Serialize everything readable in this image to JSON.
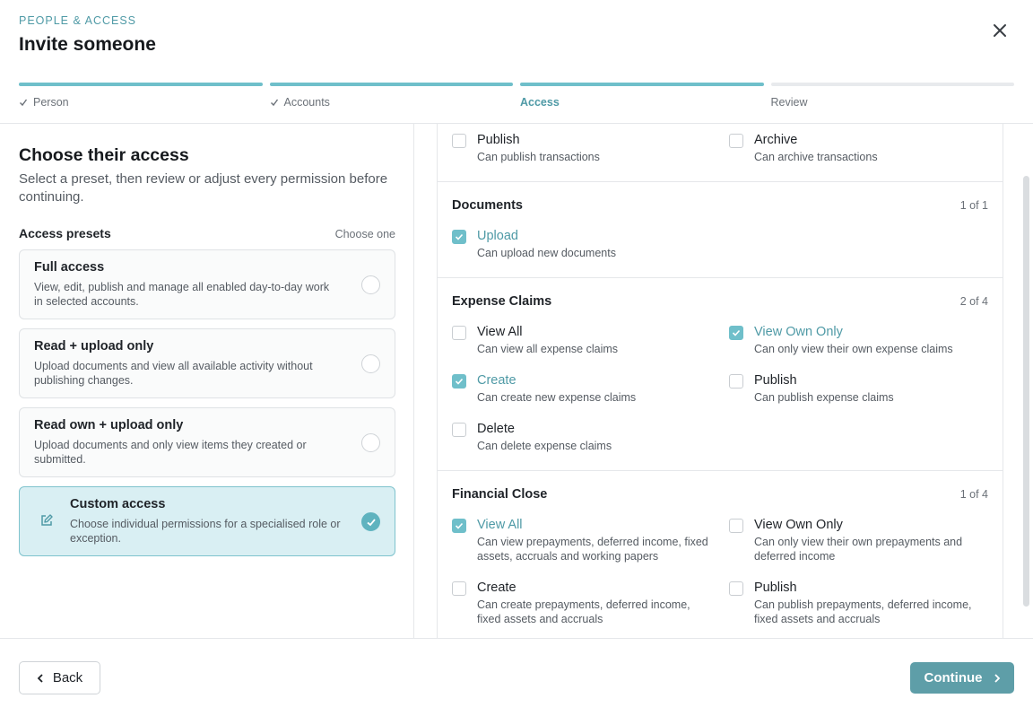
{
  "header": {
    "eyebrow": "PEOPLE & ACCESS",
    "title": "Invite someone",
    "close_icon": "close-icon"
  },
  "steps": [
    {
      "label": "Person",
      "state": "done"
    },
    {
      "label": "Accounts",
      "state": "done"
    },
    {
      "label": "Access",
      "state": "active"
    },
    {
      "label": "Review",
      "state": "upcoming"
    }
  ],
  "left": {
    "title": "Choose their access",
    "description": "Select a preset, then review or adjust every permission before continuing.",
    "presets_heading": "Access presets",
    "presets_hint": "Choose one",
    "presets": [
      {
        "title": "Full access",
        "description": "View, edit, publish and manage all enabled day-to-day work in selected accounts.",
        "selected": false
      },
      {
        "title": "Read + upload only",
        "description": "Upload documents and view all available activity without publishing changes.",
        "selected": false
      },
      {
        "title": "Read own + upload only",
        "description": "Upload documents and only view items they created or submitted.",
        "selected": false
      },
      {
        "title": "Custom access",
        "description": "Choose individual permissions for a specialised role or exception.",
        "selected": true,
        "icon": "edit-icon"
      }
    ]
  },
  "sections": {
    "top": {
      "perms": [
        {
          "name": "Publish",
          "desc": "Can publish transactions",
          "checked": false
        },
        {
          "name": "Archive",
          "desc": "Can archive transactions",
          "checked": false
        }
      ]
    },
    "documents": {
      "name": "Documents",
      "count": "1 of 1",
      "perms": [
        {
          "name": "Upload",
          "desc": "Can upload new documents",
          "checked": true
        }
      ]
    },
    "expense": {
      "name": "Expense Claims",
      "count": "2 of 4",
      "perms": [
        {
          "name": "View All",
          "desc": "Can view all expense claims",
          "checked": false
        },
        {
          "name": "View Own Only",
          "desc": "Can only view their own expense claims",
          "checked": true
        },
        {
          "name": "Create",
          "desc": "Can create new expense claims",
          "checked": true
        },
        {
          "name": "Publish",
          "desc": "Can publish expense claims",
          "checked": false
        },
        {
          "name": "Delete",
          "desc": "Can delete expense claims",
          "checked": false
        }
      ]
    },
    "financial": {
      "name": "Financial Close",
      "count": "1 of 4",
      "perms": [
        {
          "name": "View All",
          "desc": "Can view prepayments, deferred income, fixed assets, accruals and working papers",
          "checked": true
        },
        {
          "name": "View Own Only",
          "desc": "Can only view their own prepayments and deferred income",
          "checked": false
        },
        {
          "name": "Create",
          "desc": "Can create prepayments, deferred income, fixed assets and accruals",
          "checked": false
        },
        {
          "name": "Publish",
          "desc": "Can publish prepayments, deferred income, fixed assets and accruals",
          "checked": false
        }
      ]
    }
  },
  "footer": {
    "back_label": "Back",
    "continue_label": "Continue"
  },
  "colors": {
    "accent": "#6fbfca",
    "accent_text": "#4f9aa6",
    "primary_button": "#5e9ea8",
    "selected_bg": "#d9eff3"
  }
}
